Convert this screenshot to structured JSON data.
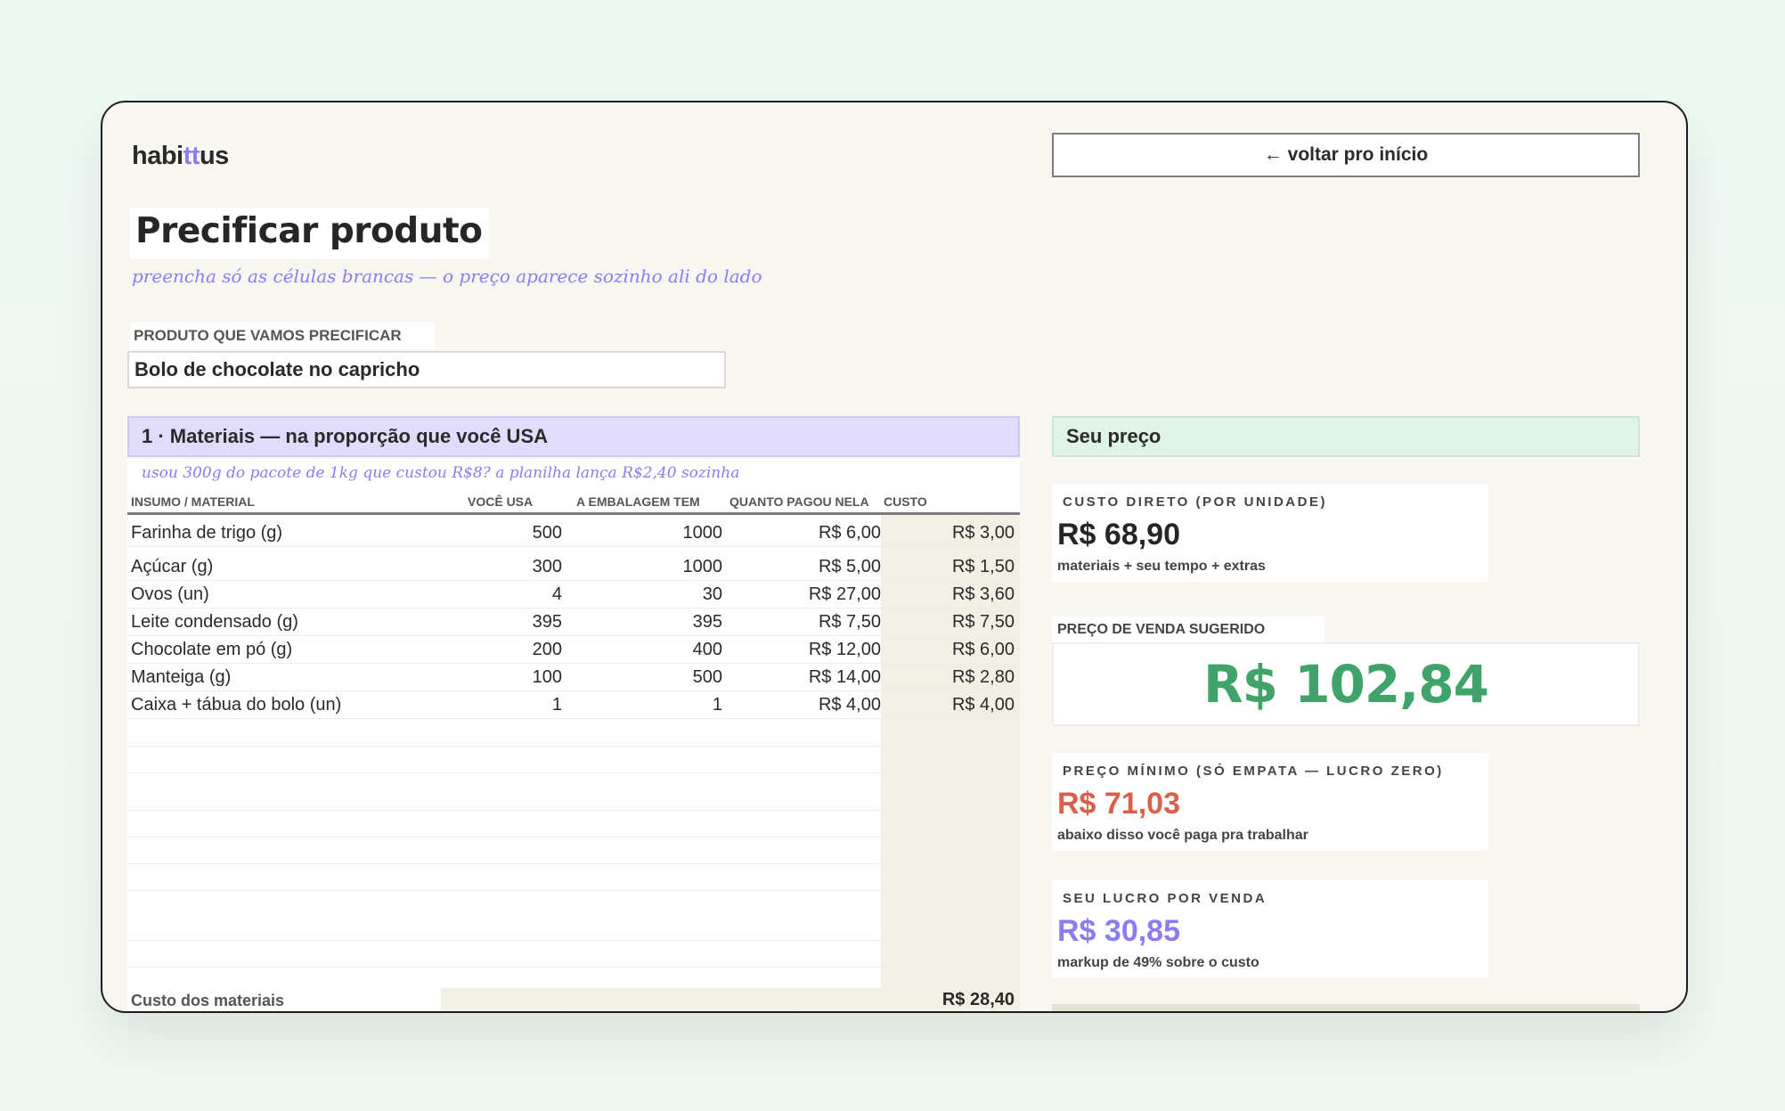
{
  "app": {
    "logo_pre": "habi",
    "logo_tt": "tt",
    "logo_post": "us",
    "back_label": "← voltar pro início"
  },
  "page": {
    "title": "Precificar produto",
    "subtitle": "preencha só as células brancas — o preço aparece sozinho ali do lado",
    "product_label": "PRODUTO QUE VAMOS PRECIFICAR",
    "product_value": "Bolo de chocolate no capricho"
  },
  "materials": {
    "header": "1 · Materiais — na proporção que você USA",
    "hint": "usou 300g do pacote de 1kg que custou R$8? a planilha lança R$2,40 sozinha",
    "columns": [
      "INSUMO / MATERIAL",
      "VOCÊ USA",
      "A EMBALAGEM TEM",
      "QUANTO PAGOU NELA",
      "CUSTO"
    ],
    "rows": [
      {
        "name": "Farinha de trigo (g)",
        "usa": "500",
        "emb": "1000",
        "paid": "R$ 6,00",
        "cost": "R$ 3,00"
      },
      {
        "name": "Açúcar (g)",
        "usa": "300",
        "emb": "1000",
        "paid": "R$ 5,00",
        "cost": "R$ 1,50"
      },
      {
        "name": "Ovos (un)",
        "usa": "4",
        "emb": "30",
        "paid": "R$ 27,00",
        "cost": "R$ 3,60"
      },
      {
        "name": "Leite condensado (g)",
        "usa": "395",
        "emb": "395",
        "paid": "R$ 7,50",
        "cost": "R$ 7,50"
      },
      {
        "name": "Chocolate em pó (g)",
        "usa": "200",
        "emb": "400",
        "paid": "R$ 12,00",
        "cost": "R$ 6,00"
      },
      {
        "name": "Manteiga (g)",
        "usa": "100",
        "emb": "500",
        "paid": "R$ 14,00",
        "cost": "R$ 2,80"
      },
      {
        "name": "Caixa + tábua do bolo (un)",
        "usa": "1",
        "emb": "1",
        "paid": "R$ 4,00",
        "cost": "R$ 4,00"
      }
    ],
    "total_label": "Custo dos materiais",
    "total_value": "R$ 28,40"
  },
  "price": {
    "header": "Seu preço",
    "direct_label": "CUSTO DIRETO (POR UNIDADE)",
    "direct_value": "R$ 68,90",
    "direct_sub": "materiais + seu tempo + extras",
    "suggested_label": "PREÇO DE VENDA SUGERIDO",
    "suggested_value": "R$ 102,84",
    "min_label": "PREÇO MÍNIMO (SÓ EMPATA — LUCRO ZERO)",
    "min_value": "R$ 71,03",
    "min_sub": "abaixo disso você paga pra trabalhar",
    "profit_label": "SEU LUCRO POR VENDA",
    "profit_value": "R$ 30,85",
    "profit_sub": "markup de 49% sobre o custo"
  },
  "colors": {
    "purple": "#8b7cf0",
    "green": "#3fa36a",
    "red": "#d9604a",
    "accent_bg": "#e1dcfb"
  }
}
